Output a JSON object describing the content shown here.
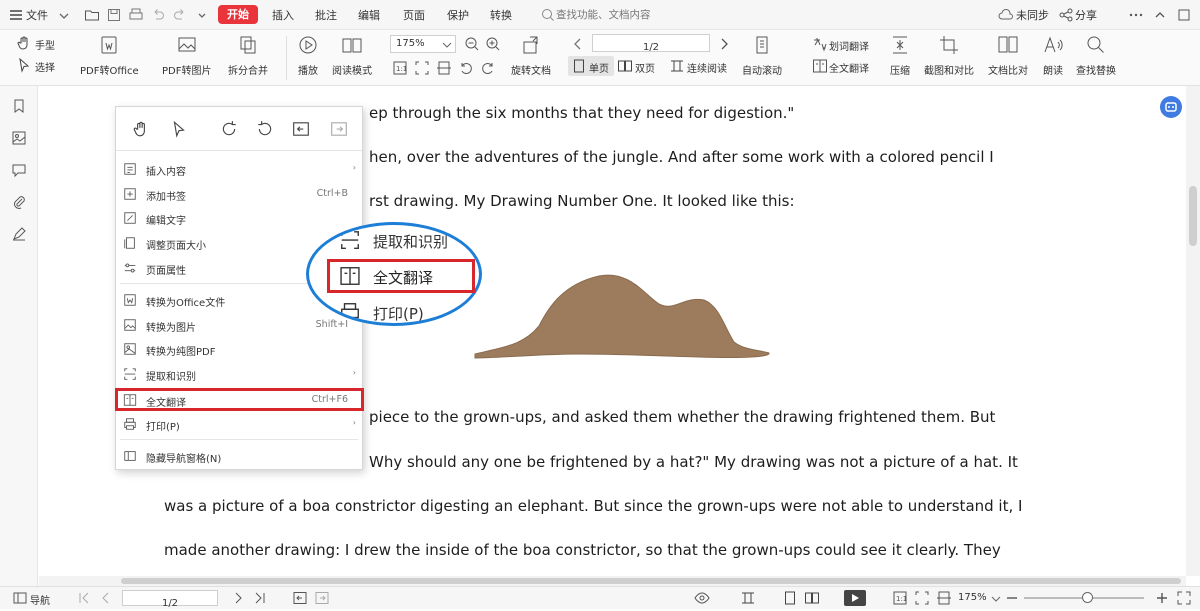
{
  "menubar": {
    "file": "文件",
    "tabs": [
      "开始",
      "插入",
      "批注",
      "编辑",
      "页面",
      "保护",
      "转换"
    ],
    "search_placeholder": "查找功能、文档内容",
    "sync": "未同步",
    "share": "分享"
  },
  "toolbar": {
    "hand": "手型",
    "select": "选择",
    "pdf_to_office": "PDF转Office",
    "pdf_to_image": "PDF转图片",
    "split_merge": "拆分合并",
    "play": "播放",
    "read_mode": "阅读模式",
    "zoom": "175%",
    "page": "1/2",
    "rotate": "旋转文档",
    "single": "单页",
    "double": "双页",
    "continuous": "连续阅读",
    "auto_scroll": "自动滚动",
    "word_translate": "划词翻译",
    "full_translate": "全文翻译",
    "compress": "压缩",
    "screenshot_compare": "截图和对比",
    "doc_compare": "文档比对",
    "read_aloud": "朗读",
    "find_replace": "查找替换"
  },
  "document": {
    "lines": [
      "ep through the six months that they need for digestion.\"",
      "hen, over the adventures of the jungle. And after some work with a colored pencil I",
      "rst drawing. My Drawing Number One. It looked like this:",
      "piece to the grown-ups, and asked them whether the drawing frightened them. But",
      "Why should any one be frightened by a hat?\" My drawing was not a picture of a hat. It",
      "was a picture of a boa constrictor digesting an elephant. But since the grown-ups were not able to understand it, I",
      "made another drawing: I drew the inside of the boa constrictor, so that the grown-ups could see it clearly. They"
    ]
  },
  "context_menu": {
    "items": [
      {
        "label": "插入内容",
        "shortcut": "",
        "arrow": "›"
      },
      {
        "label": "添加书签",
        "shortcut": "Ctrl+B",
        "arrow": ""
      },
      {
        "label": "编辑文字",
        "shortcut": "",
        "arrow": ""
      },
      {
        "label": "调整页面大小",
        "shortcut": "",
        "arrow": ""
      },
      {
        "label": "页面属性",
        "shortcut": "",
        "arrow": ""
      },
      {
        "label": "转换为Office文件",
        "shortcut": "",
        "arrow": ""
      },
      {
        "label": "转换为图片",
        "shortcut": "Shift+I",
        "arrow": ""
      },
      {
        "label": "转换为纯图PDF",
        "shortcut": "",
        "arrow": ""
      },
      {
        "label": "提取和识别",
        "shortcut": "",
        "arrow": "›"
      },
      {
        "label": "全文翻译",
        "shortcut": "Ctrl+F6",
        "arrow": ""
      },
      {
        "label": "打印(P)",
        "shortcut": "",
        "arrow": "›"
      },
      {
        "label": "隐藏导航窗格(N)",
        "shortcut": "",
        "arrow": ""
      }
    ]
  },
  "magnifier": {
    "top": "提取和识别",
    "middle": "全文翻译",
    "bottom": "打印(P)"
  },
  "statusbar": {
    "nav": "导航",
    "page": "1/2",
    "zoom": "175%"
  },
  "colors": {
    "accent": "#e8343a",
    "highlight": "#d8262d",
    "callout": "#1c7ed6",
    "drawing": "#9c7c5d"
  }
}
